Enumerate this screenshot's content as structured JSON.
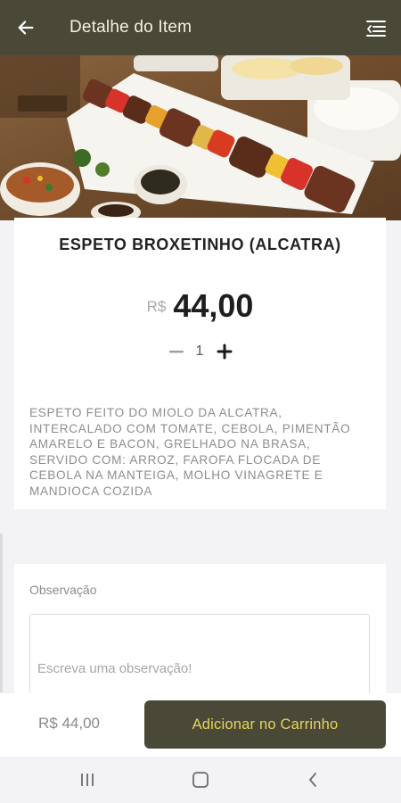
{
  "header": {
    "title": "Detalhe do Item",
    "back_icon": "arrow-left-icon",
    "menu_icon": "menu-lines-icon"
  },
  "item": {
    "name": "ESPETO BROXETINHO (ALCATRA)",
    "currency": "R$",
    "price": "44,00",
    "quantity": "1",
    "description": "ESPETO FEITO DO MIOLO DA ALCATRA, INTERCALADO COM TOMATE, CEBOLA, PIMENTÃO AMARELO E BACON, GRELHADO NA BRASA, SERVIDO COM: ARROZ, FAROFA FLOCADA DE CEBOLA NA MANTEIGA, MOLHO VINAGRETE E MANDIOCA COZIDA"
  },
  "observation": {
    "label": "Observação",
    "placeholder": "Escreva uma observação!"
  },
  "footer": {
    "total": "R$ 44,00",
    "add_button": "Adicionar no Carrinho"
  },
  "colors": {
    "brand": "#4a4837",
    "button_text": "#e6d65a"
  }
}
